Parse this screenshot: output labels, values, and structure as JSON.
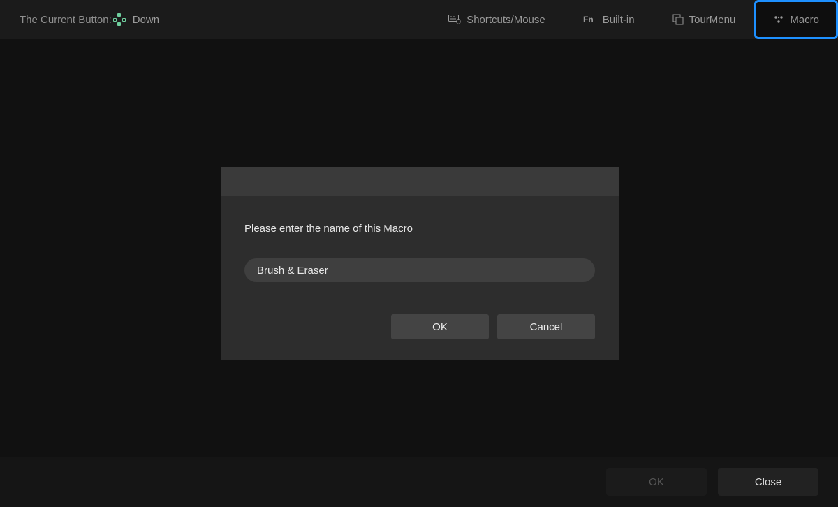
{
  "header": {
    "current_button_label": "The Current Button:",
    "current_button_value": "Down"
  },
  "tabs": {
    "shortcuts": "Shortcuts/Mouse",
    "builtin": "Built-in",
    "tourmenu": "TourMenu",
    "macro": "Macro"
  },
  "dialog": {
    "prompt": "Please enter the name of this Macro",
    "input_value": "Brush & Eraser",
    "ok": "OK",
    "cancel": "Cancel"
  },
  "footer": {
    "ok": "OK",
    "close": "Close"
  }
}
